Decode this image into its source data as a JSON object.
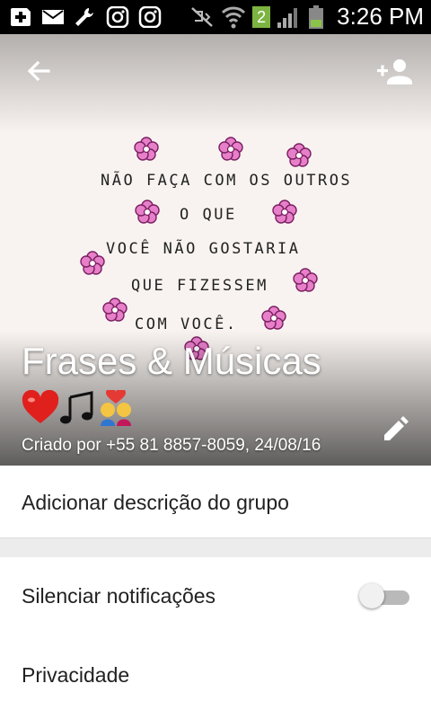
{
  "status_bar": {
    "time": "3:26 PM",
    "notification_badge": "2",
    "icons": [
      "add-box-icon",
      "mail-icon",
      "wrench-icon",
      "instagram-icon",
      "instagram-icon",
      "vibrate-off-icon",
      "wifi-icon",
      "signal-icon",
      "battery-icon"
    ]
  },
  "group_header": {
    "title": "Frases & Músicas",
    "subtitle_emojis": [
      "red-heart-emoji",
      "music-notes-emoji",
      "couple-with-heart-emoji"
    ],
    "created": "Criado por +55 81 8857-8059, 24/08/16",
    "image_text_lines": [
      "NÃO FAÇA COM OS OUTROS",
      "O QUE",
      "VOCÊ NÃO GOSTARIA",
      "QUE FIZESSEM",
      "COM VOCÊ."
    ],
    "accent_color": "#ff1493"
  },
  "description_row": {
    "label": "Adicionar descrição do grupo"
  },
  "settings": {
    "mute_label": "Silenciar notificações",
    "mute_enabled": false,
    "privacy_label": "Privacidade"
  }
}
